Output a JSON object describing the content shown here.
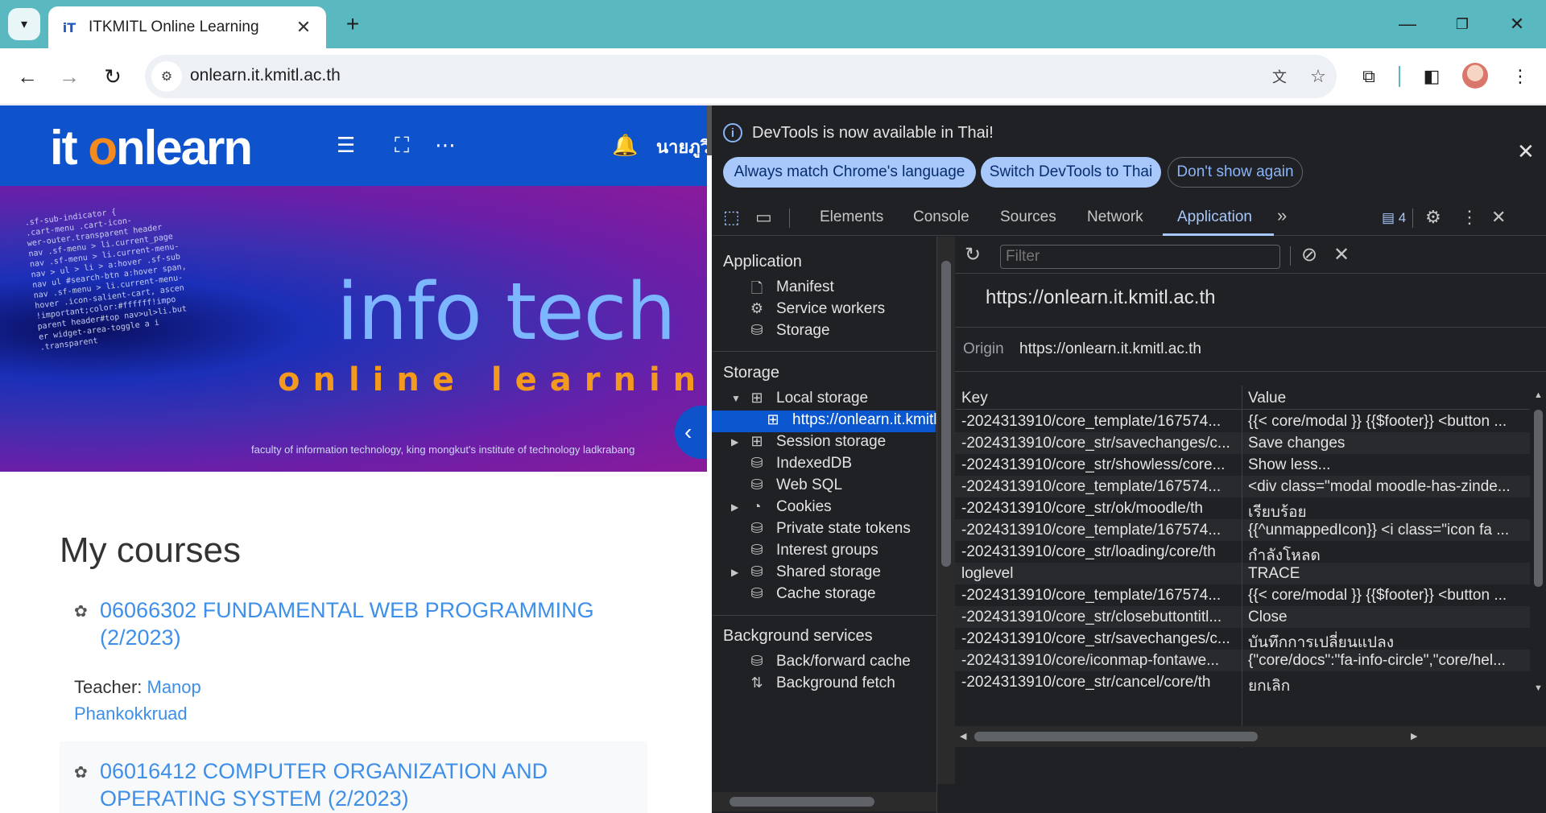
{
  "browser": {
    "tab_title": "ITKMITL Online Learning",
    "url": "onlearn.it.kmitl.ac.th"
  },
  "site": {
    "logo_left": "it ",
    "logo_o": "o",
    "logo_right": "nlearn",
    "user_name": "นายภูวิ",
    "banner_title": "info tech",
    "banner_subtitle": "online learning",
    "banner_caption": "faculty of information technology, king mongkut's institute of technology ladkrabang",
    "banner_code": ".sf-sub-indicator {\n.cart-menu .cart-icon-\nwer-outer.transparent header\nnav .sf-menu > li.current_page\nnav .sf-menu > li.current-menu-\nnav > ul > li > a:hover .sf-sub\nnav ul #search-btn a:hover span,\nnav .sf-menu > li.current-menu-\nhover .icon-salient-cart, ascen\n!important;color:#ffffff!impo\nparent header#top nav>ul>li.but\ner widget-area-toggle a i\n.transparent",
    "courses_title": "My courses",
    "courses": [
      {
        "title": "06066302 FUNDAMENTAL WEB PROGRAMMING (2/2023)"
      },
      {
        "title": "06016412 COMPUTER ORGANIZATION AND OPERATING SYSTEM (2/2023)"
      }
    ],
    "teacher_label": "Teacher: ",
    "teacher_name": "Manop Phankokkruad"
  },
  "devtools": {
    "info_message": "DevTools is now available in Thai!",
    "pill_match": "Always match Chrome's language",
    "pill_switch": "Switch DevTools to Thai",
    "pill_dont_show": "Don't show again",
    "tabs": [
      "Elements",
      "Console",
      "Sources",
      "Network",
      "Application"
    ],
    "issues_count": "4",
    "sidebar": {
      "app_header": "Application",
      "app_items": [
        "Manifest",
        "Service workers",
        "Storage"
      ],
      "storage_header": "Storage",
      "local_storage": "Local storage",
      "local_origin": "https://onlearn.it.kmitl.ac.th",
      "storage_items": [
        "Session storage",
        "IndexedDB",
        "Web SQL",
        "Cookies",
        "Private state tokens",
        "Interest groups",
        "Shared storage",
        "Cache storage"
      ],
      "bg_header": "Background services",
      "bg_items": [
        "Back/forward cache",
        "Background fetch"
      ]
    },
    "filter_placeholder": "Filter",
    "origin_title": "https://onlearn.it.kmitl.ac.th",
    "origin_label": "Origin",
    "origin_value": "https://onlearn.it.kmitl.ac.th",
    "table_headers": {
      "key": "Key",
      "value": "Value"
    },
    "rows": [
      {
        "key": "-2024313910/core_template/167574...",
        "value": "{{< core/modal }} {{$footer}} <button ..."
      },
      {
        "key": "-2024313910/core_str/savechanges/c...",
        "value": "Save changes"
      },
      {
        "key": "-2024313910/core_str/showless/core...",
        "value": "Show less..."
      },
      {
        "key": "-2024313910/core_template/167574...",
        "value": "<div class=\"modal moodle-has-zinde..."
      },
      {
        "key": "-2024313910/core_str/ok/moodle/th",
        "value": "เรียบร้อย"
      },
      {
        "key": "-2024313910/core_template/167574...",
        "value": "{{^unmappedIcon}} <i class=\"icon fa ..."
      },
      {
        "key": "-2024313910/core_str/loading/core/th",
        "value": "กำลังโหลด"
      },
      {
        "key": "loglevel",
        "value": "TRACE"
      },
      {
        "key": "-2024313910/core_template/167574...",
        "value": "{{< core/modal }} {{$footer}} <button ..."
      },
      {
        "key": "-2024313910/core_str/closebuttontitl...",
        "value": "Close"
      },
      {
        "key": "-2024313910/core_str/savechanges/c...",
        "value": "บันทึกการเปลี่ยนแปลง"
      },
      {
        "key": "-2024313910/core/iconmap-fontawe...",
        "value": "{\"core/docs\":\"fa-info-circle\",\"core/hel..."
      },
      {
        "key": "-2024313910/core_str/cancel/core/th",
        "value": "ยกเลิก"
      }
    ]
  }
}
